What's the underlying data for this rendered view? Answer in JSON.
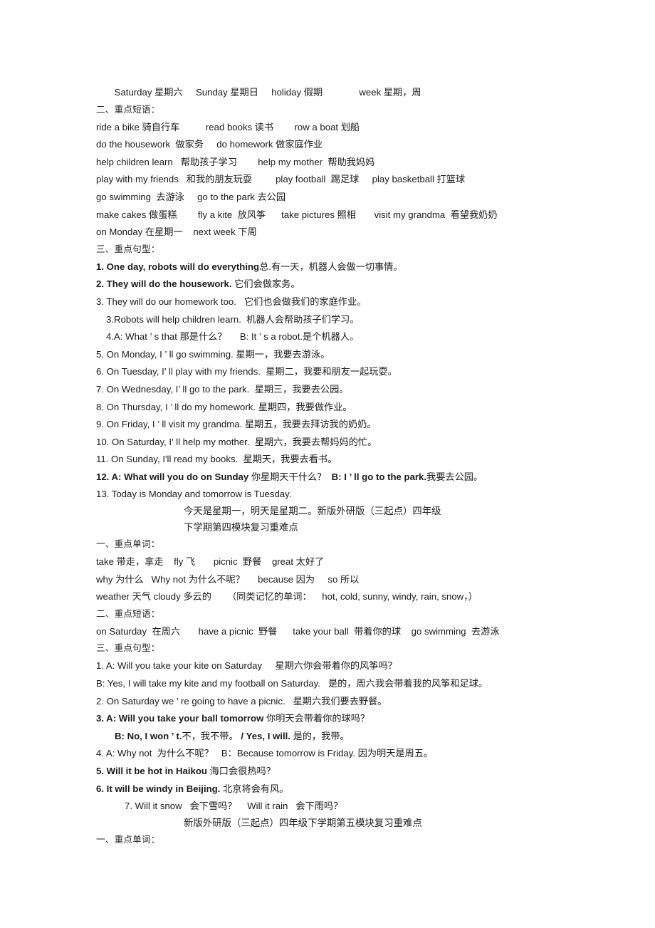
{
  "document": {
    "page_background": "#ffffff",
    "text_color": "#1a1a1a",
    "lines": {
      "l01_vocab_days": "       Saturday 星期六     Sunday 星期日     holiday 假期              week 星期，周",
      "l02_head_phrases": "二、重点短语：",
      "l03": "ride a bike 骑自行车          read books 读书        row a boat 划船",
      "l04": "do the housework  做家务     do homework 做家庭作业",
      "l05": "help children learn   帮助孩子学习        help my mother  帮助我妈妈",
      "l06": "play with my friends   和我的朋友玩耍         play football  踢足球     play basketball 打篮球",
      "l07": "go swimming  去游泳     go to the park 去公园",
      "l08": "make cakes 做蛋糕        fly a kite  放风筝      take pictures 照相       visit my grandma  看望我奶奶",
      "l09": "on Monday 在星期一    next week 下周",
      "l10_head_sentences": "三、重点句型：",
      "s1_bold": "1. One day, robots will do everything",
      "s1_rest": "总.有一天，机器人会做一切事情。",
      "s2_bold": "2. They will do the housework.",
      "s2_rest": " 它们会做家务。",
      "s3": "3. They will do our homework too.   它们也会做我们的家庭作业。",
      "s3b": "3.Robots will help children learn.  机器人会帮助孩子们学习。",
      "s4": "4.A: What ’ s that 那是什么？     B: It ’ s a robot.是个机器人。",
      "s5": "5. On Monday, I ’ ll go swimming. 星期一，我要去游泳。",
      "s6": "6. On Tuesday, I’ ll play with my friends.  星期二，我要和朋友一起玩耍。",
      "s7": "7. On Wednesday, I’ ll go to the park.  星期三，我要去公园。",
      "s8": "8. On Thursday, I ’ ll do my homework. 星期四，我要做作业。",
      "s9": "9. On Friday, I ’ ll visit my grandma. 星期五，我要去拜访我的奶奶。",
      "s10": "10. On Saturday, I’ ll help my mother.  星期六，我要去帮妈妈的忙。",
      "s11": "11. On Sunday, I'll read my books.  星期天，我要去看书。",
      "s12_bold_a": "12. A: What will you do on Sunday",
      "s12_mid": " 你星期天干什么？ ",
      "s12_bold_b": " B: I ’ ll go to the park.",
      "s12_rest": "我要去公园。",
      "s13": "13. Today is Monday and tomorrow is Tuesday.",
      "m4_title_line1": "今天是星期一，明天是星期二。新版外研版（三起点）四年级",
      "m4_title_line2": "下学期第四模块复习重难点",
      "m4_head_words": "一、重点单词：",
      "m4_w1": "take 带走，拿走    fly 飞       picnic  野餐    great 太好了",
      "m4_w2": "why 为什么   Why not 为什么不呢？     because 因为     so 所以",
      "m4_w3": "weather 天气 cloudy 多云的      （同类记忆的单词：    hot, cold, sunny, windy, rain, snow，）",
      "m4_head_phrases": "二、重点短语：",
      "m4_p1": "on Saturday  在周六       have a picnic  野餐      take your ball  带着你的球    go swimming  去游泳",
      "m4_head_sentences": "三、重点句型：",
      "m4_s1a": "1. A: Will you take your kite on Saturday     星期六你会带着你的风筝吗？",
      "m4_s1b": "B: Yes, I will take my kite and my football on Saturday.   是的，周六我会带着我的风筝和足球。",
      "m4_s2": "2. On Saturday we ’ re going to have a picnic.   星期六我们要去野餐。",
      "m4_s3_bold": "3. A: Will you take your ball tomorrow",
      "m4_s3_rest": " 你明天会带着你的球吗？",
      "m4_s3b_bold1": "B: No, I won ’ t.",
      "m4_s3b_mid": "不，我不带。 ",
      "m4_s3b_bold2": "/ Yes, I will.",
      "m4_s3b_rest": " 是的，我带。",
      "m4_s4": "4. A: Why not  为什么不呢？   B：Because tomorrow is Friday. 因为明天是周五。",
      "m4_s5_bold": "5. Will it be hot in Haikou",
      "m4_s5_rest": " 海口会很热吗？",
      "m4_s6_bold": "6. It will be windy in Beijing.",
      "m4_s6_rest": " 北京将会有风。",
      "m4_s7": "7. Will it snow   会下雪吗？    Will it rain   会下雨吗？",
      "m5_title": "新版外研版（三起点）四年级下学期第五模块复习重难点",
      "m5_head_words": "一、重点单词："
    }
  }
}
